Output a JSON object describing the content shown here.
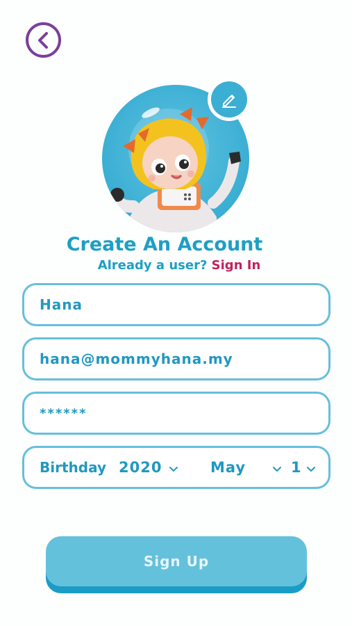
{
  "header": {
    "back_icon": "chevron-left-icon"
  },
  "avatar": {
    "edit_icon": "pencil-icon"
  },
  "title": "Create An Account",
  "subtitle": {
    "prompt": "Already a user?",
    "link": "Sign In"
  },
  "form": {
    "name": "Hana",
    "email": "hana@mommyhana.my",
    "password": "******",
    "birthday": {
      "label": "Birthday",
      "year": "2020",
      "month": "May",
      "day": "1"
    }
  },
  "signup_label": "Sign Up",
  "colors": {
    "accent": "#1d9fc4",
    "link": "#c4205f",
    "back": "#7a3f9a",
    "button": "#64c1dc",
    "button_shadow": "#1b9cc6"
  }
}
